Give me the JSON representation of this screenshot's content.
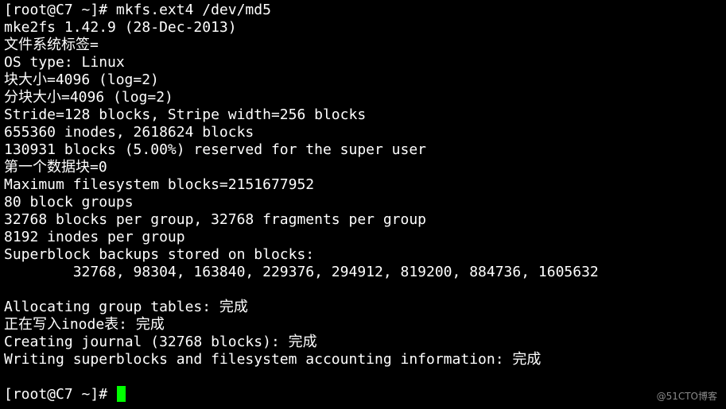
{
  "terminal": {
    "cursor_color": "#00ff00",
    "background_color": "#000000",
    "text_color": "#ffffff",
    "lines": [
      "[root@C7 ~]# mkfs.ext4 /dev/md5",
      "mke2fs 1.42.9 (28-Dec-2013)",
      "文件系统标签=",
      "OS type: Linux",
      "块大小=4096 (log=2)",
      "分块大小=4096 (log=2)",
      "Stride=128 blocks, Stripe width=256 blocks",
      "655360 inodes, 2618624 blocks",
      "130931 blocks (5.00%) reserved for the super user",
      "第一个数据块=0",
      "Maximum filesystem blocks=2151677952",
      "80 block groups",
      "32768 blocks per group, 32768 fragments per group",
      "8192 inodes per group",
      "Superblock backups stored on blocks:",
      "        32768, 98304, 163840, 229376, 294912, 819200, 884736, 1605632",
      "",
      "Allocating group tables: 完成",
      "正在写入inode表: 完成",
      "Creating journal (32768 blocks): 完成",
      "Writing superblocks and filesystem accounting information: 完成",
      ""
    ],
    "prompt": "[root@C7 ~]# "
  },
  "watermark": {
    "text": "@51CTO博客"
  }
}
